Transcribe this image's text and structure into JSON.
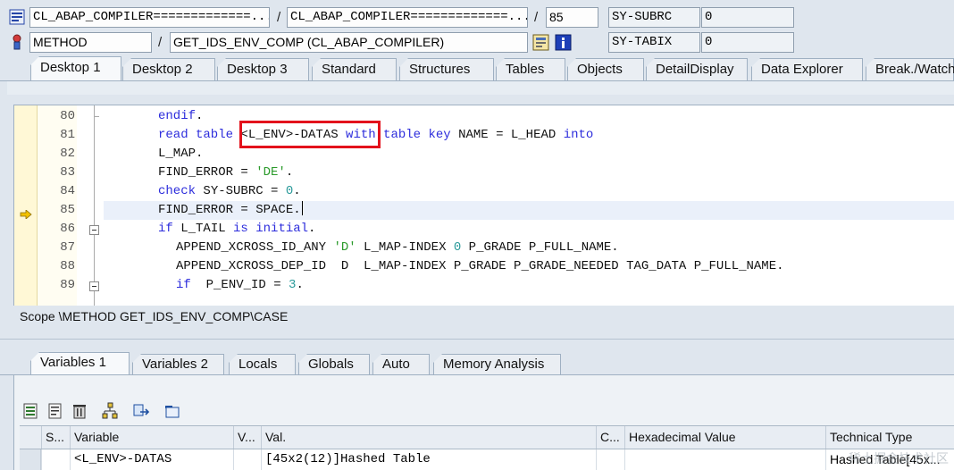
{
  "header": {
    "program": "CL_ABAP_COMPILER=============...",
    "include": "CL_ABAP_COMPILER=============...",
    "line": "85",
    "event_type": "METHOD",
    "event": "GET_IDS_ENV_COMP (CL_ABAP_COMPILER)",
    "sys_fields": [
      {
        "name": "SY-SUBRC",
        "value": "0"
      },
      {
        "name": "SY-TABIX",
        "value": "0"
      }
    ]
  },
  "desktop_tabs": [
    "Desktop 1",
    "Desktop 2",
    "Desktop 3",
    "Standard",
    "Structures",
    "Tables",
    "Objects",
    "DetailDisplay",
    "Data Explorer",
    "Break./Watch"
  ],
  "code": {
    "lines": [
      {
        "no": "80",
        "text": "endif."
      },
      {
        "no": "81",
        "text": "read table <L_ENV>-DATAS with table key NAME = L_HEAD into"
      },
      {
        "no": "82",
        "text": "L_MAP."
      },
      {
        "no": "83",
        "text": "FIND_ERROR = 'DE'."
      },
      {
        "no": "84",
        "text": "check SY-SUBRC = 0."
      },
      {
        "no": "85",
        "text": "FIND_ERROR = SPACE."
      },
      {
        "no": "86",
        "text": "if L_TAIL is initial."
      },
      {
        "no": "87",
        "text": "APPEND_XCROSS_ID_ANY 'D' L_MAP-INDEX 0 P_GRADE P_FULL_NAME."
      },
      {
        "no": "88",
        "text": "APPEND_XCROSS_DEP_ID  D  L_MAP-INDEX P_GRADE P_GRADE_NEEDED TAG_DATA P_FULL_NAME."
      },
      {
        "no": "89",
        "text": "if  P_ENV_ID = 3."
      }
    ],
    "current_line": "85"
  },
  "scope": "Scope \\METHOD GET_IDS_ENV_COMP\\CASE",
  "variable_tabs": [
    "Variables 1",
    "Variables 2",
    "Locals",
    "Globals",
    "Auto",
    "Memory Analysis"
  ],
  "grid": {
    "columns": [
      "S...",
      "Variable",
      "V...",
      "Val.",
      "C...",
      "Hexadecimal Value",
      "Technical Type"
    ],
    "rows": [
      {
        "variable": "<L_ENV>-DATAS",
        "value": "[45x2(12)]Hashed Table",
        "technical_type": "Hashed Table[45x..."
      }
    ]
  },
  "watermark": "稀土掘金技术社区"
}
